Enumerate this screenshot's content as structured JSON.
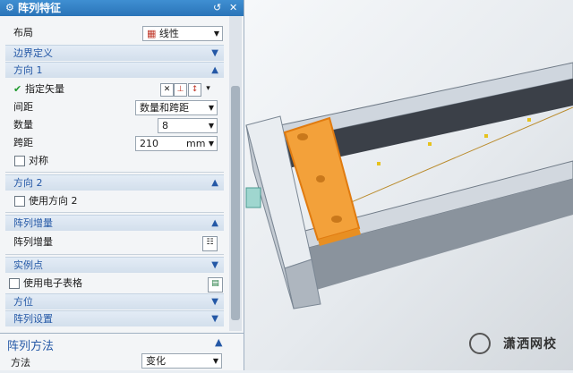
{
  "dialog": {
    "title": "阵列特征",
    "layout_label": "布局",
    "layout_value": "线性",
    "sections": {
      "boundary": "边界定义",
      "direction1": "方向 1",
      "direction2": "方向 2",
      "pattern_increment": "阵列增量",
      "instance_points": "实例点",
      "orientation": "方位",
      "pattern_settings": "阵列设置"
    },
    "dir1": {
      "specify_vector": "指定矢量",
      "spacing_label": "间距",
      "spacing_value": "数量和跨距",
      "count_label": "数量",
      "count_value": "8",
      "span_label": "跨距",
      "span_value": "210",
      "span_unit": "mm",
      "symmetric_label": "对称"
    },
    "dir2": {
      "use_dir2_label": "使用方向 2"
    },
    "increment": {
      "label": "阵列增量"
    },
    "instance": {
      "use_spreadsheet_label": "使用电子表格"
    },
    "pattern_method": {
      "header": "阵列方法",
      "method_label": "方法",
      "method_value": "变化"
    }
  },
  "watermark": "潇洒网校",
  "colors": {
    "title_blue": "#2a74b8",
    "section_blue": "#2458a6",
    "highlight_orange": "#f3a13a"
  }
}
